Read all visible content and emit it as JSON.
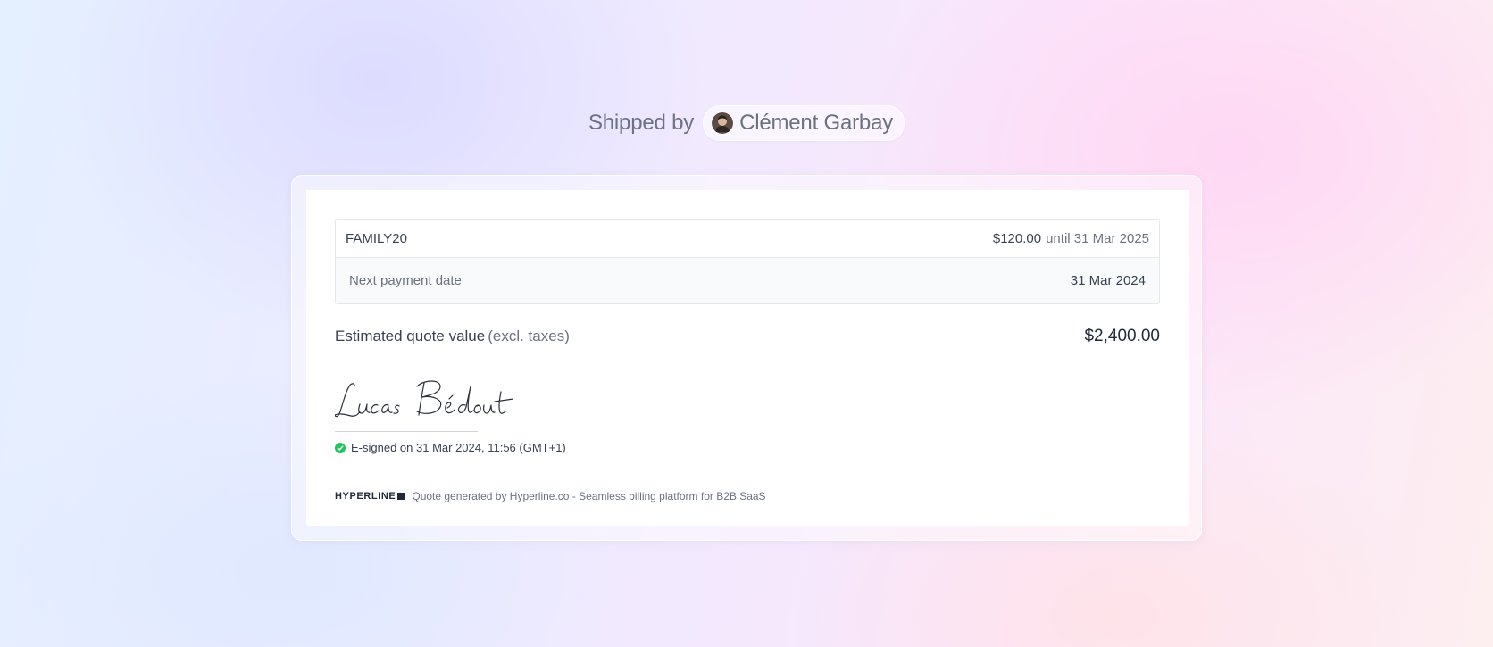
{
  "header": {
    "shipped_label": "Shipped by",
    "author_name": "Clément Garbay",
    "avatar_icon": "avatar-photo"
  },
  "quote": {
    "coupon": {
      "code": "FAMILY20",
      "amount": "$120.00",
      "until": "until 31 Mar 2025"
    },
    "next_payment": {
      "label": "Next payment date",
      "value": "31 Mar 2024"
    },
    "estimate": {
      "label": "Estimated quote value",
      "note": "(excl. taxes)",
      "value": "$2,400.00"
    },
    "signature": {
      "signer": "Lucas Bédout",
      "status_icon": "check-circle-icon",
      "esigned_text": "E-signed on 31 Mar 2024, 11:56 (GMT+1)"
    },
    "footer": {
      "brand": "HYPERLINE",
      "text": "Quote generated by Hyperline.co - Seamless billing platform for B2B SaaS"
    }
  },
  "colors": {
    "text_primary": "#1f2937",
    "text_muted": "#6b7280",
    "success": "#22c55e",
    "border": "#e5e7eb"
  }
}
